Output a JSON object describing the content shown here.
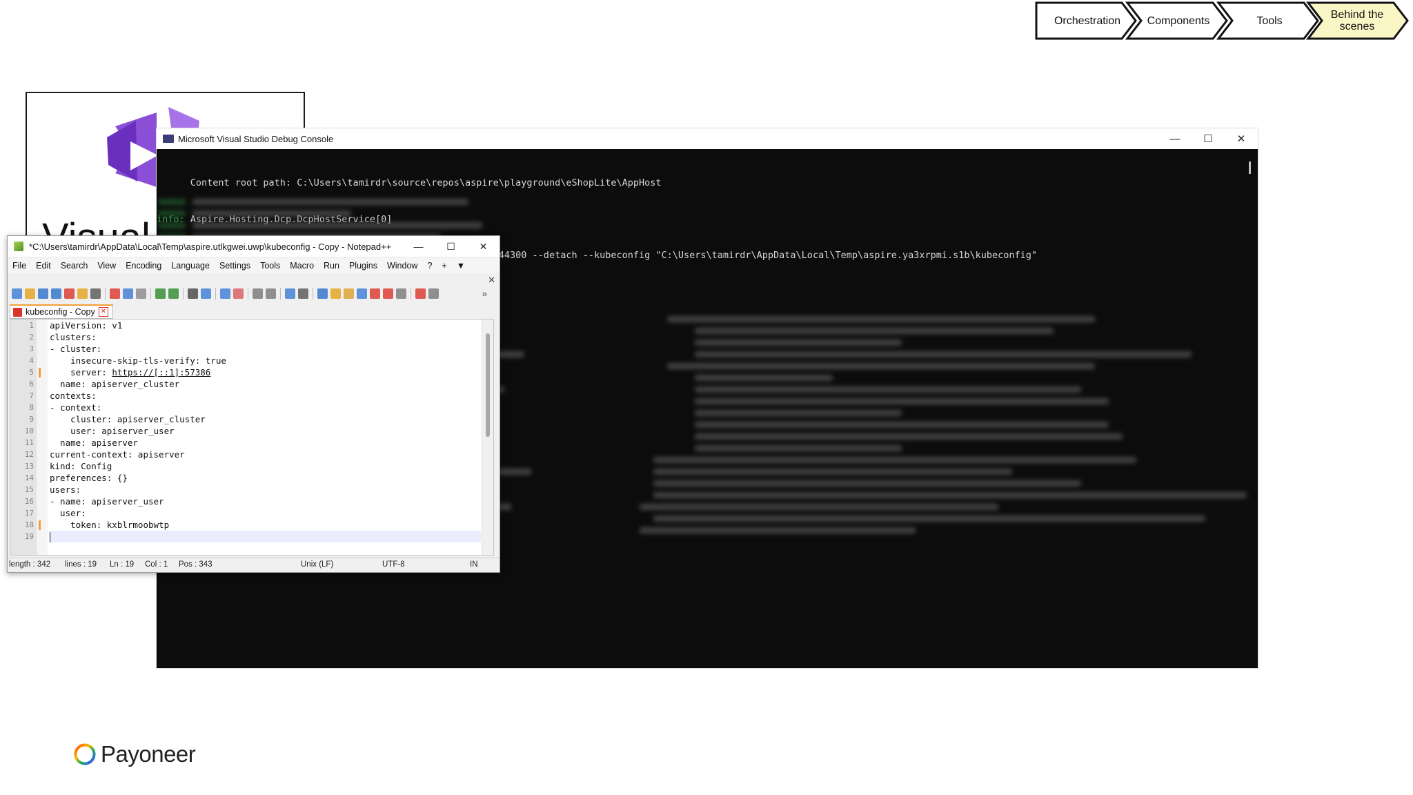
{
  "breadcrumb": {
    "items": [
      {
        "label": "Orchestration",
        "active": false
      },
      {
        "label": "Components",
        "active": false
      },
      {
        "label": "Tools",
        "active": false
      },
      {
        "label": "Behind the scenes",
        "active": true
      }
    ],
    "active_color": "#fbf6c6"
  },
  "slide": {
    "title_fragment": "Visual"
  },
  "console": {
    "title": "Microsoft Visual Studio Debug Console",
    "lines": [
      {
        "tag": "",
        "text": "      Content root path: C:\\Users\\tamirdr\\source\\repos\\aspire\\playground\\eShopLite\\AppHost"
      },
      {
        "tag": "info:",
        "text": " Aspire.Hosting.Dcp.DcpHostService[0]"
      },
      {
        "tag": "",
        "text": "      Starting DCP with arguments: start-apiserver --monitor 44300 --detach --kubeconfig \"C:\\Users\\tamirdr\\AppData\\Local\\Temp\\aspire.ya3xrpmi.s1b\\kubeconfig\""
      }
    ],
    "background": "#0c0c0c",
    "info_color": "#2fb34f"
  },
  "notepad": {
    "title": "*C:\\Users\\tamirdr\\AppData\\Local\\Temp\\aspire.utlkgwei.uwp\\kubeconfig - Copy - Notepad++",
    "menu": [
      "File",
      "Edit",
      "Search",
      "View",
      "Encoding",
      "Language",
      "Settings",
      "Tools",
      "Macro",
      "Run",
      "Plugins",
      "Window",
      "?",
      "+",
      "▼"
    ],
    "tab_label": "kubeconfig - Copy",
    "lines": [
      {
        "n": "1",
        "text": "apiVersion: v1",
        "changed": false
      },
      {
        "n": "2",
        "text": "clusters:",
        "changed": false
      },
      {
        "n": "3",
        "text": "- cluster:",
        "changed": false
      },
      {
        "n": "4",
        "text": "    insecure-skip-tls-verify: true",
        "changed": false
      },
      {
        "n": "5",
        "text": "    server: ",
        "url": "https://[::1]:57386",
        "changed": true
      },
      {
        "n": "6",
        "text": "  name: apiserver_cluster",
        "changed": false
      },
      {
        "n": "7",
        "text": "contexts:",
        "changed": false
      },
      {
        "n": "8",
        "text": "- context:",
        "changed": false
      },
      {
        "n": "9",
        "text": "    cluster: apiserver_cluster",
        "changed": false
      },
      {
        "n": "10",
        "text": "    user: apiserver_user",
        "changed": false
      },
      {
        "n": "11",
        "text": "  name: apiserver",
        "changed": false
      },
      {
        "n": "12",
        "text": "current-context: apiserver",
        "changed": false
      },
      {
        "n": "13",
        "text": "kind: Config",
        "changed": false
      },
      {
        "n": "14",
        "text": "preferences: {}",
        "changed": false
      },
      {
        "n": "15",
        "text": "users:",
        "changed": false
      },
      {
        "n": "16",
        "text": "- name: apiserver_user",
        "changed": false
      },
      {
        "n": "17",
        "text": "  user:",
        "changed": false
      },
      {
        "n": "18",
        "text": "    token: kxblrmoobwtp",
        "changed": true
      },
      {
        "n": "19",
        "text": "",
        "changed": false,
        "current": true
      }
    ],
    "status": {
      "length": "length : 342",
      "lines": "lines : 19",
      "ln": "Ln : 19",
      "col": "Col : 1",
      "pos": "Pos : 343",
      "eol": "Unix (LF)",
      "encoding": "UTF-8",
      "mode": "IN"
    },
    "changed_color": "#f29e38"
  },
  "logo": {
    "text": "Payoneer"
  }
}
